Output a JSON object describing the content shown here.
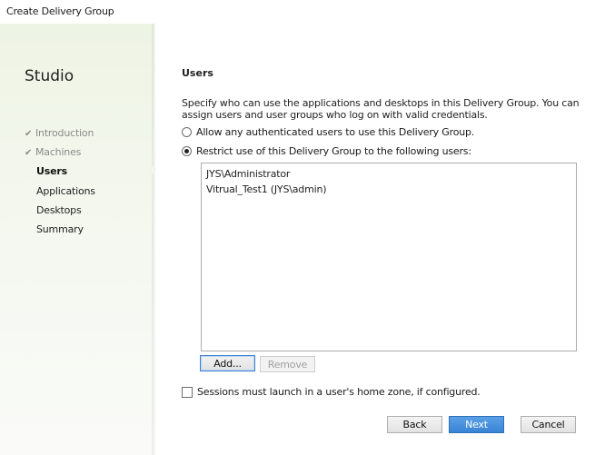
{
  "window": {
    "title": "Create Delivery Group"
  },
  "sidebar": {
    "brand": "Studio",
    "items": [
      {
        "label": "Introduction",
        "state": "done"
      },
      {
        "label": "Machines",
        "state": "done"
      },
      {
        "label": "Users",
        "state": "active"
      },
      {
        "label": "Applications",
        "state": "todo"
      },
      {
        "label": "Desktops",
        "state": "todo"
      },
      {
        "label": "Summary",
        "state": "todo"
      }
    ],
    "check_icon": "checkmark-icon"
  },
  "main": {
    "section_title": "Users",
    "description": "Specify who can use the applications and desktops in this Delivery Group. You can assign users and user groups who log on with valid credentials.",
    "options": [
      {
        "label": "Allow any authenticated users to use this Delivery Group.",
        "selected": false
      },
      {
        "label": "Restrict use of this Delivery Group to the following users:",
        "selected": true
      }
    ],
    "users": [
      "JYS\\Administrator",
      "Vitrual_Test1 (JYS\\admin)"
    ],
    "add_label": "Add...",
    "remove_label": "Remove",
    "home_zone_label": "Sessions must launch in a user's home zone, if configured.",
    "home_zone_checked": false
  },
  "footer": {
    "back_label": "Back",
    "next_label": "Next",
    "cancel_label": "Cancel"
  },
  "colors": {
    "accent": "#3a84d6",
    "sidebar_bg": "#eef4e4"
  }
}
